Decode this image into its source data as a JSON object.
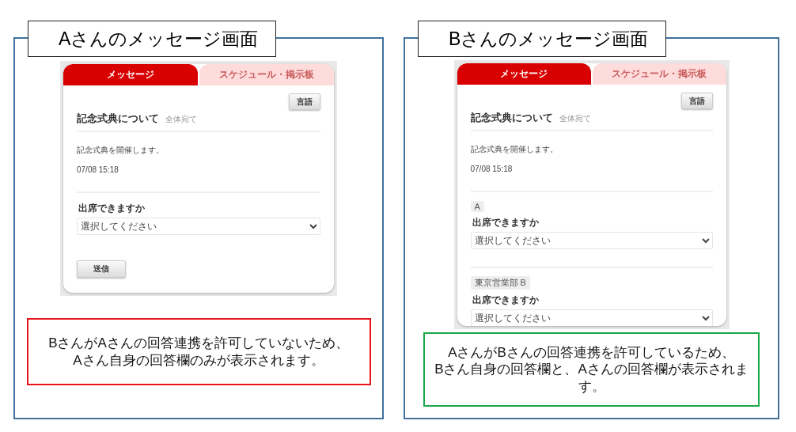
{
  "panels": [
    {
      "title": "Aさんのメッセージ画面",
      "screen": {
        "tabs": [
          {
            "label": "メッセージ",
            "selected": true
          },
          {
            "label": "スケジュール・掲示板",
            "selected": false
          }
        ],
        "language_button": "言語",
        "subject": "記念式典について",
        "audience": "全体宛て",
        "body": "記念式典を開催します。",
        "timestamp": "07/08 15:18",
        "answers": [
          {
            "question": "出席できますか",
            "value": "選択してください"
          }
        ],
        "submit_button": "送信"
      },
      "caption": {
        "text": "BさんがAさんの回答連携を許可していないため、\nAさん自身の回答欄のみが表示されます。",
        "color": "#e8141c"
      }
    },
    {
      "title": "Bさんのメッセージ画面",
      "screen": {
        "tabs": [
          {
            "label": "メッセージ",
            "selected": true
          },
          {
            "label": "スケジュール・掲示板",
            "selected": false
          }
        ],
        "language_button": "言語",
        "subject": "記念式典について",
        "audience": "全体宛て",
        "body": "記念式典を開催します。",
        "timestamp": "07/08 15:18",
        "answers": [
          {
            "respondent": "A",
            "question": "出席できますか",
            "value": "選択してください"
          },
          {
            "respondent": "東京営業部 B",
            "question": "出席できますか",
            "value": "選択してください"
          }
        ]
      },
      "caption": {
        "text": "AさんがBさんの回答連携を許可しているため、\nBさん自身の回答欄と、Aさんの回答欄が表示されます。",
        "color": "#1aa84b"
      }
    }
  ]
}
